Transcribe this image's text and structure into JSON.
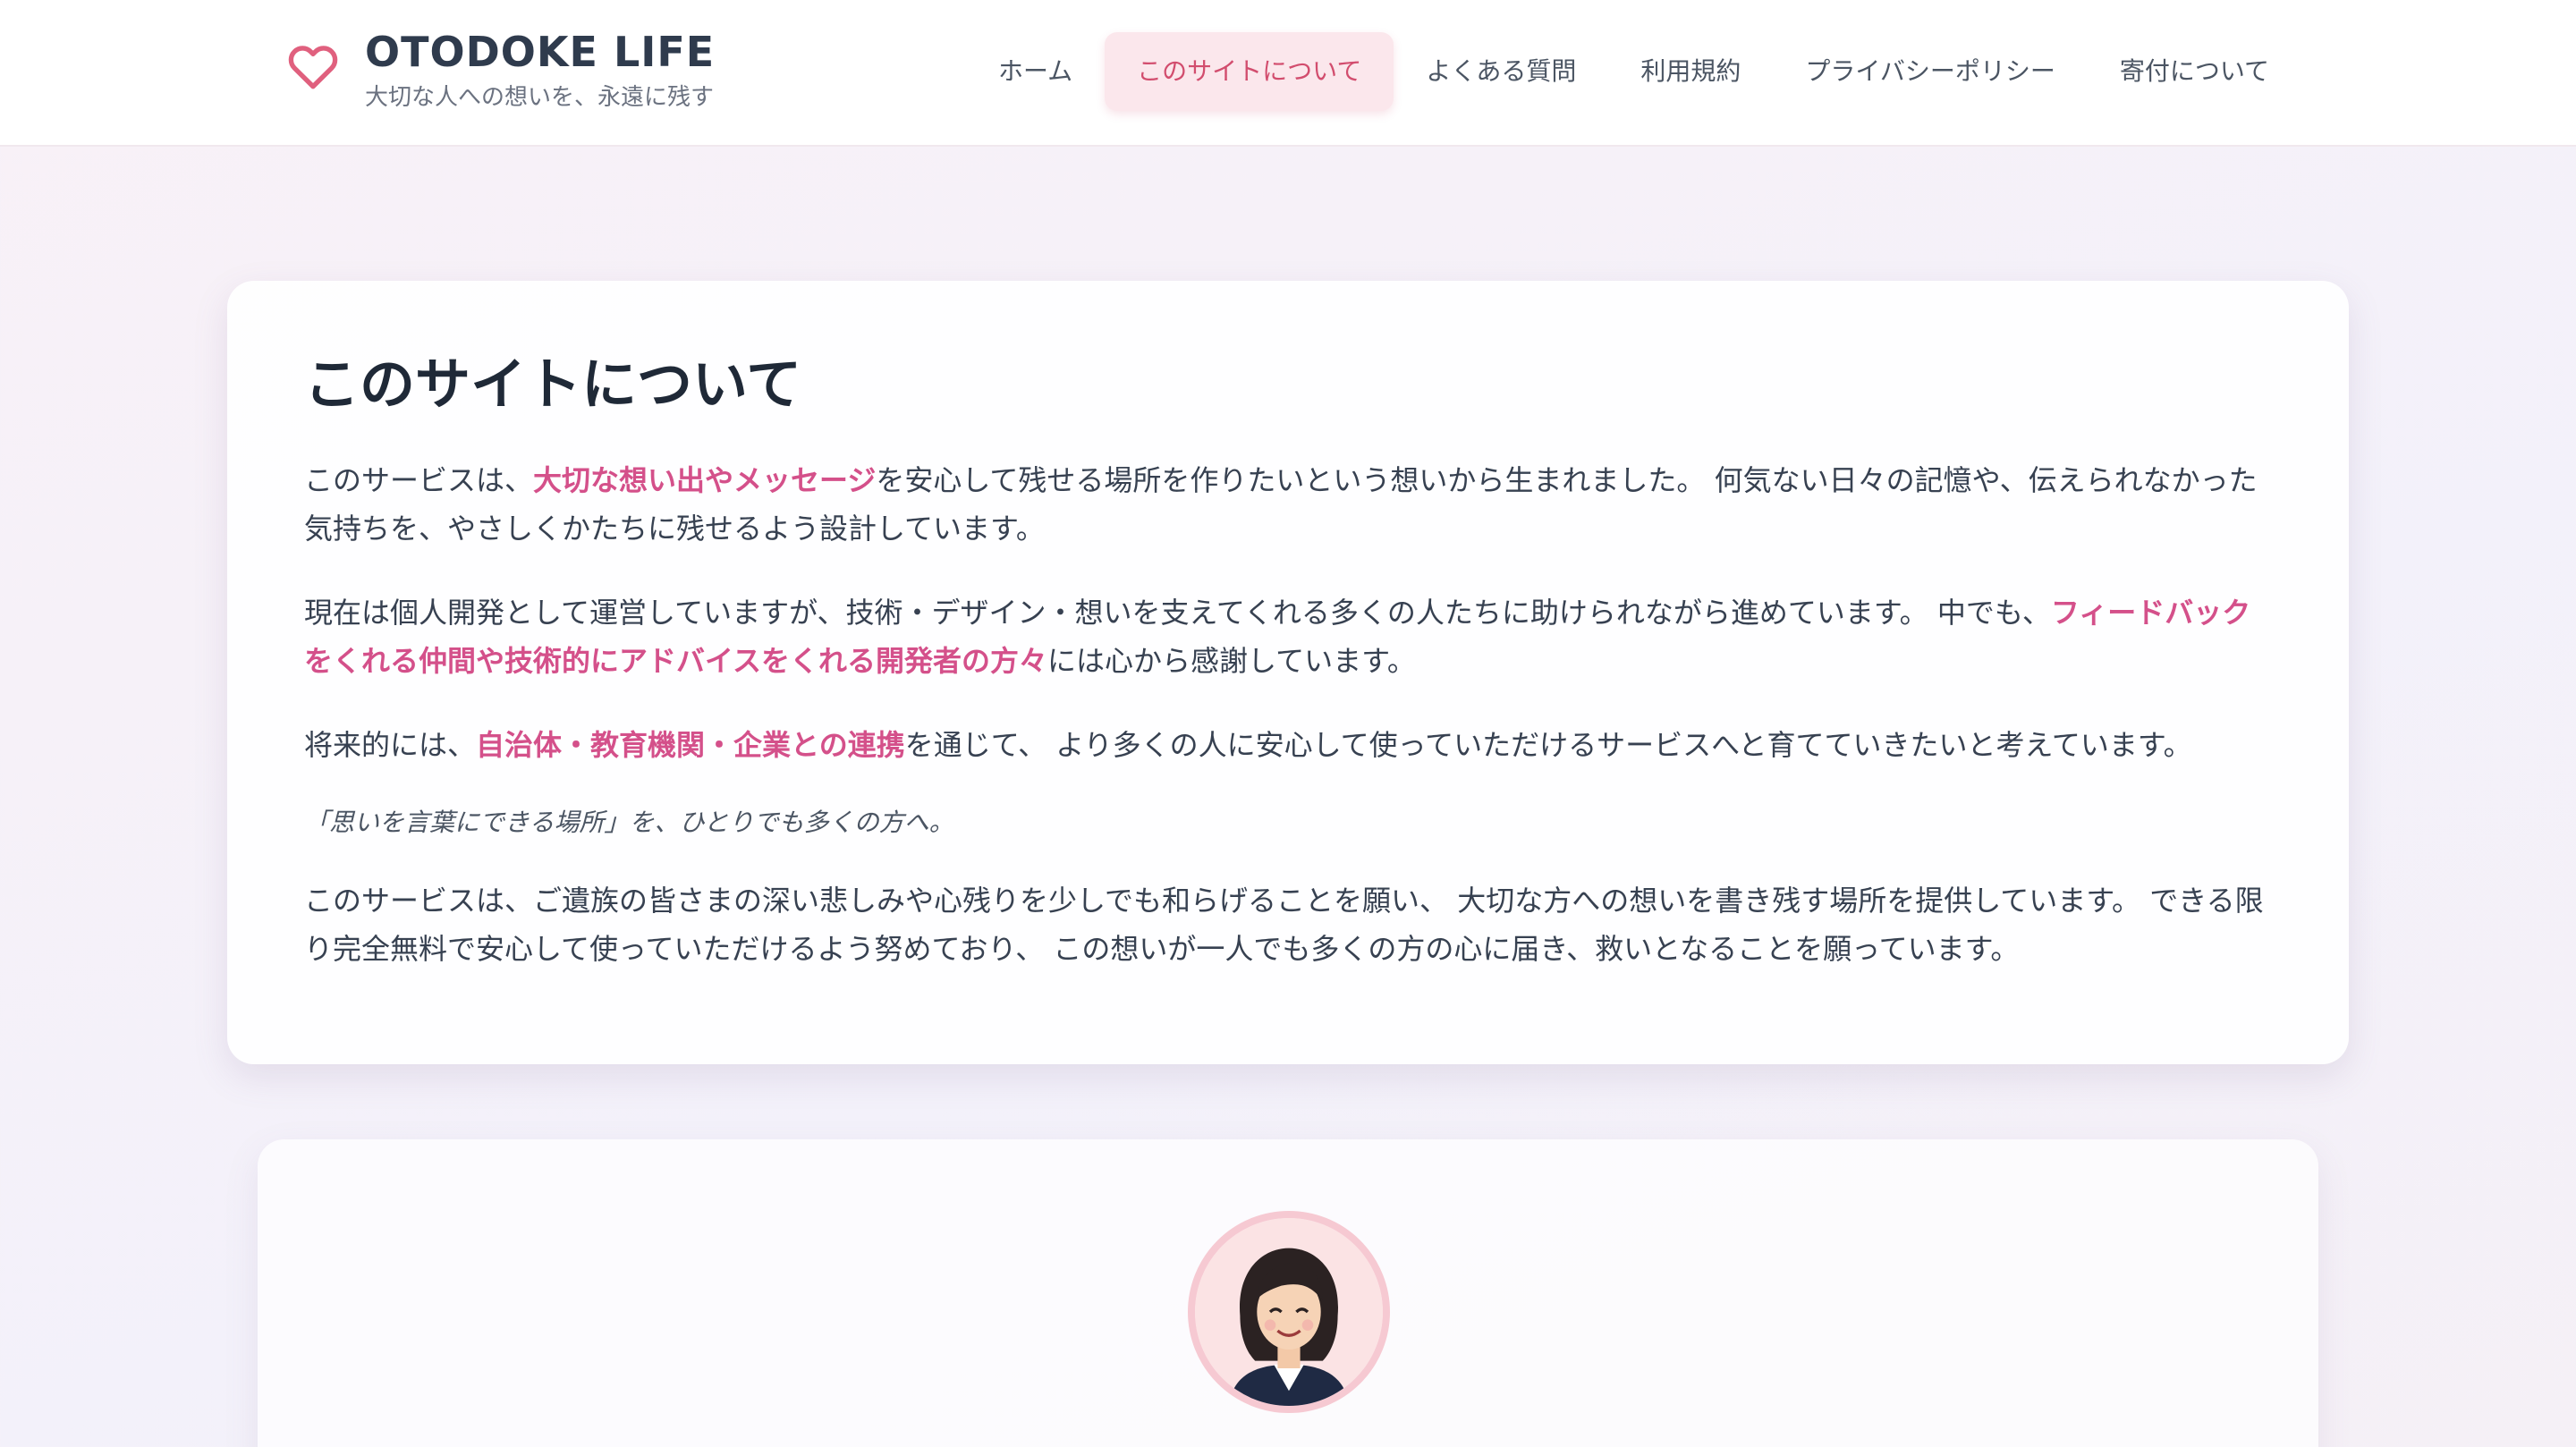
{
  "brand": {
    "title": "OTODOKE LIFE",
    "subtitle": "大切な人への想いを、永遠に残す",
    "icon": "heart-icon",
    "accent_color": "#e0607e"
  },
  "nav": {
    "items": [
      {
        "label": "ホーム",
        "active": false
      },
      {
        "label": "このサイトについて",
        "active": true
      },
      {
        "label": "よくある質問",
        "active": false
      },
      {
        "label": "利用規約",
        "active": false
      },
      {
        "label": "プライバシーポリシー",
        "active": false
      },
      {
        "label": "寄付について",
        "active": false
      }
    ]
  },
  "about": {
    "heading": "このサイトについて",
    "p1": {
      "before": "このサービスは、",
      "highlight": "大切な想い出やメッセージ",
      "after": "を安心して残せる場所を作りたいという想いから生まれました。 何気ない日々の記憶や、伝えられなかった気持ちを、やさしくかたちに残せるよう設計しています。"
    },
    "p2": {
      "before": "現在は個人開発として運営していますが、技術・デザイン・想いを支えてくれる多くの人たちに助けられながら進めています。 中でも、",
      "highlight": "フィードバックをくれる仲間や技術的にアドバイスをくれる開発者の方々",
      "after": "には心から感謝しています。"
    },
    "p3": {
      "before": "将来的には、",
      "highlight": "自治体・教育機関・企業との連携",
      "after": "を通じて、 より多くの人に安心して使っていただけるサービスへと育てていきたいと考えています。"
    },
    "quote": "「思いを言葉にできる場所」を、ひとりでも多くの方へ。",
    "p4": "このサービスは、ご遺族の皆さまの深い悲しみや心残りを少しでも和らげることを願い、 大切な方への想いを書き残す場所を提供しています。 できる限り完全無料で安心して使っていただけるよう努めており、 この想いが一人でも多くの方の心に届き、救いとなることを願っています。",
    "highlight_color": "#d4508a"
  },
  "profile": {
    "avatar_icon": "avatar"
  }
}
